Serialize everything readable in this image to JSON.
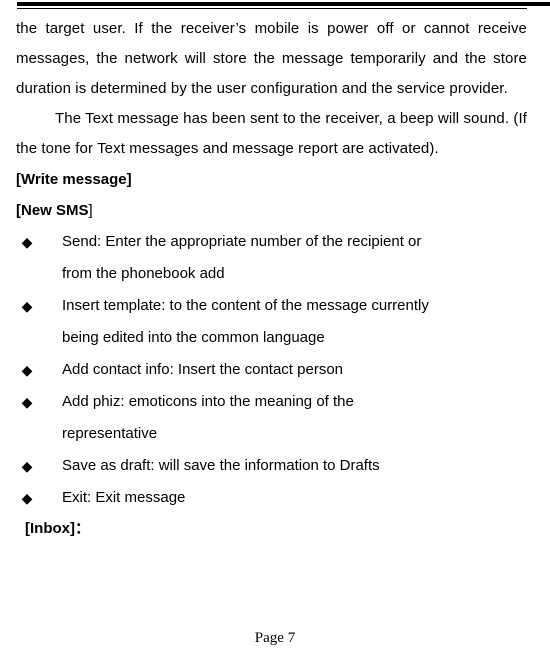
{
  "document": {
    "header_rule": {
      "style": "double-line"
    },
    "paragraphs": [
      {
        "id": "network-storage",
        "text": "the target user. If the receiver’s mobile is power off or cannot receive messages, the network will store the message temporarily and the store duration is determined by the user configuration and the service provider."
      },
      {
        "id": "beep-notice",
        "text": "The Text message has been sent to the receiver, a beep will sound. (If the tone for Text messages and message report are activated)."
      }
    ],
    "headings": {
      "write_message": "[Write message]",
      "new_sms_bold": "[New SMS",
      "new_sms_tail": "]",
      "inbox": "[Inbox]："
    },
    "bullets": [
      {
        "marker": "◆",
        "text": "Send: Enter the appropriate number of the recipient or from the phonebook add",
        "line1": "Send: Enter the appropriate number of the recipient or",
        "line2": "from the phonebook add"
      },
      {
        "marker": "◆",
        "text": "Insert template: to the content of the message currently being edited into the common language",
        "line1": "Insert template: to the content of the message currently",
        "line2": "being edited into the common language"
      },
      {
        "marker": "◆",
        "text": "Add contact info: Insert the contact person",
        "line1": "Add contact info: Insert the contact person",
        "line2": ""
      },
      {
        "marker": "◆",
        "text": "Add phiz: emoticons into the meaning of the representative",
        "line1": "Add phiz: emoticons into the meaning of the",
        "line2": "representative"
      },
      {
        "marker": "◆",
        "text": "Save as draft: will save the information to Drafts",
        "line1": "Save as draft: will save the information to Drafts",
        "line2": ""
      },
      {
        "marker": "◆",
        "text": "Exit: Exit message",
        "line1": "Exit: Exit message",
        "line2": ""
      }
    ],
    "footer": {
      "page_label": "Page 7"
    }
  }
}
